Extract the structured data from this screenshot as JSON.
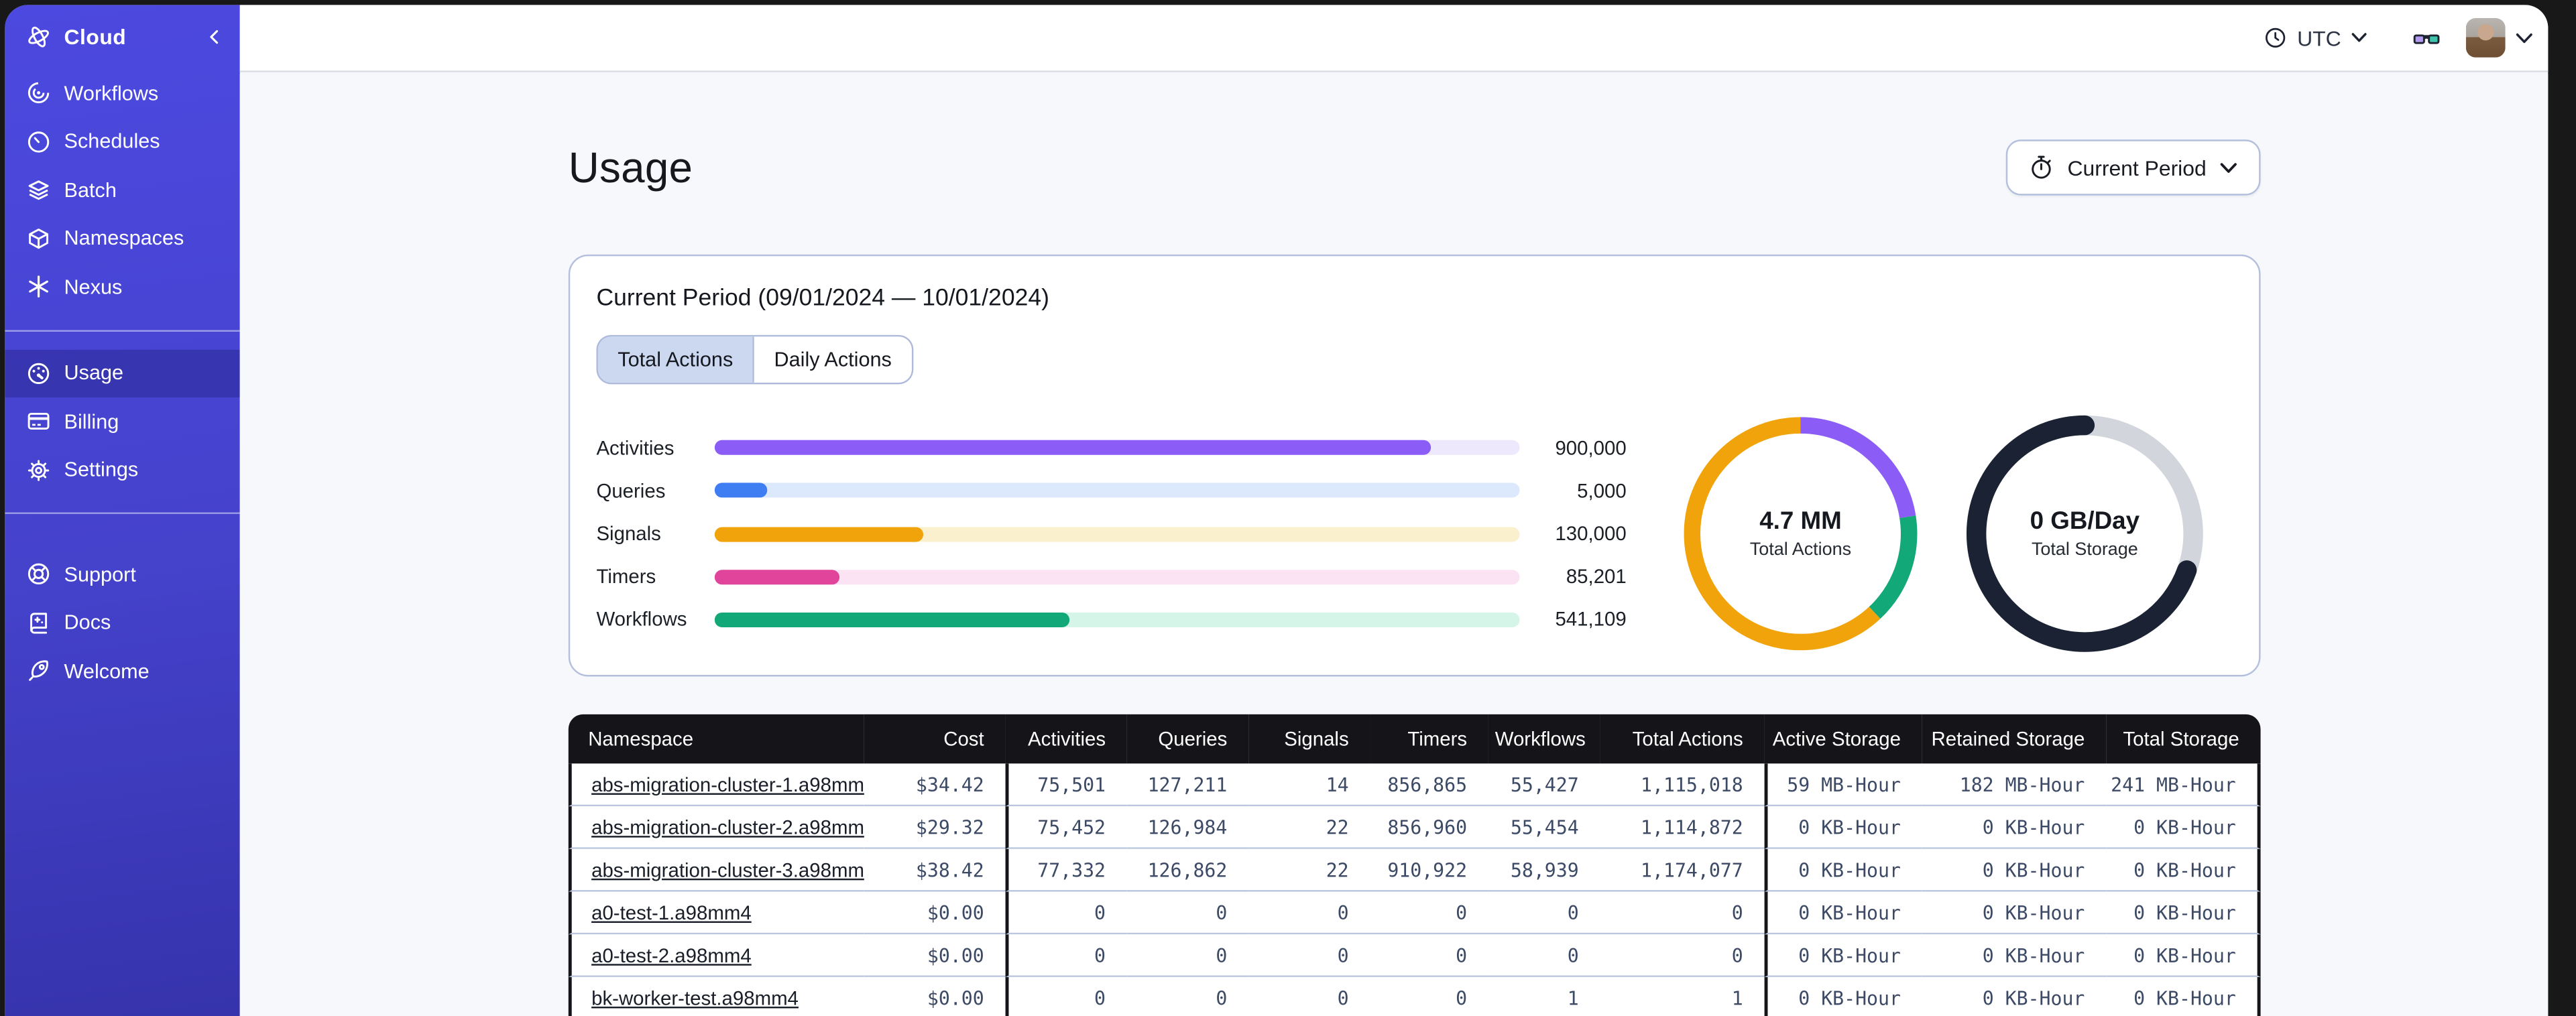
{
  "colors": {
    "sidebar_indigo": "#4542cc",
    "content_bg": "#f7f8fb",
    "table_header_bg": "#141419",
    "card_border": "#b4c0dd",
    "tab_selected_bg": "#cbd8f0"
  },
  "sidebar": {
    "header": {
      "label": "Cloud"
    },
    "sections": [
      {
        "items": [
          {
            "label": "Workflows",
            "icon": "workflows-icon"
          },
          {
            "label": "Schedules",
            "icon": "schedules-icon"
          },
          {
            "label": "Batch",
            "icon": "batch-icon"
          },
          {
            "label": "Namespaces",
            "icon": "namespaces-icon"
          },
          {
            "label": "Nexus",
            "icon": "nexus-icon"
          }
        ]
      },
      {
        "items": [
          {
            "label": "Usage",
            "icon": "usage-icon",
            "active": true
          },
          {
            "label": "Billing",
            "icon": "billing-icon"
          },
          {
            "label": "Settings",
            "icon": "settings-icon"
          }
        ]
      },
      {
        "items": [
          {
            "label": "Support",
            "icon": "support-icon"
          },
          {
            "label": "Docs",
            "icon": "docs-icon"
          },
          {
            "label": "Welcome",
            "icon": "welcome-icon"
          }
        ]
      }
    ]
  },
  "topbar": {
    "timezone_label": "UTC"
  },
  "page": {
    "title": "Usage",
    "period_button_label": "Current Period"
  },
  "usage_card": {
    "title": "Current Period (09/01/2024 — 10/01/2024)",
    "tabs": [
      {
        "label": "Total Actions",
        "selected": true
      },
      {
        "label": "Daily Actions",
        "selected": false
      }
    ],
    "bars": [
      {
        "label": "Activities",
        "value": "900,000",
        "fraction": 0.89,
        "color": "#8b5cf6",
        "track_color": "#ede8fc"
      },
      {
        "label": "Queries",
        "value": "5,000",
        "fraction": 0.065,
        "color": "#3f7df3",
        "track_color": "#dce8fb"
      },
      {
        "label": "Signals",
        "value": "130,000",
        "fraction": 0.26,
        "color": "#f0a30a",
        "track_color": "#fbf0cd"
      },
      {
        "label": "Timers",
        "value": "85,201",
        "fraction": 0.155,
        "color": "#e1459b",
        "track_color": "#fbe3f3"
      },
      {
        "label": "Workflows",
        "value": "541,109",
        "fraction": 0.44,
        "color": "#12a877",
        "track_color": "#d5f5e8"
      }
    ],
    "donuts": [
      {
        "value": "4.7 MM",
        "label": "Total Actions",
        "stroke_width": 10,
        "round_cap": false,
        "segments": [
          {
            "name": "activities",
            "color": "#8b5cf6",
            "fraction": 0.225
          },
          {
            "name": "workflows",
            "color": "#12a877",
            "fraction": 0.155
          },
          {
            "name": "signals",
            "color": "#f0a30a",
            "fraction": 0.62
          }
        ]
      },
      {
        "value": "0 GB/Day",
        "label": "Total Storage",
        "stroke_width": 12,
        "round_cap": true,
        "track_color": "#d2d5db",
        "segments": [
          {
            "name": "storage",
            "color": "#1a2233",
            "fraction": 0.695
          }
        ]
      }
    ]
  },
  "table": {
    "columns": [
      {
        "key": "namespace",
        "label": "Namespace",
        "align": "left",
        "type": "link"
      },
      {
        "key": "cost",
        "label": "Cost",
        "align": "right"
      },
      {
        "key": "activities",
        "label": "Activities",
        "align": "right",
        "divider_before": true
      },
      {
        "key": "queries",
        "label": "Queries",
        "align": "right"
      },
      {
        "key": "signals",
        "label": "Signals",
        "align": "right"
      },
      {
        "key": "timers",
        "label": "Timers",
        "align": "right"
      },
      {
        "key": "workflows",
        "label": "Workflows",
        "align": "right"
      },
      {
        "key": "total_actions",
        "label": "Total Actions",
        "align": "right"
      },
      {
        "key": "active_storage",
        "label": "Active Storage",
        "align": "right",
        "divider_before": true
      },
      {
        "key": "retained_storage",
        "label": "Retained Storage",
        "align": "right"
      },
      {
        "key": "total_storage",
        "label": "Total Storage",
        "align": "right"
      }
    ],
    "rows": [
      {
        "namespace": "abs-migration-cluster-1.a98mm4",
        "cost": "$34.42",
        "activities": "75,501",
        "queries": "127,211",
        "signals": "14",
        "timers": "856,865",
        "workflows": "55,427",
        "total_actions": "1,115,018",
        "active_storage": "59 MB-Hour",
        "retained_storage": "182 MB-Hour",
        "total_storage": "241 MB-Hour"
      },
      {
        "namespace": "abs-migration-cluster-2.a98mm4",
        "cost": "$29.32",
        "activities": "75,452",
        "queries": "126,984",
        "signals": "22",
        "timers": "856,960",
        "workflows": "55,454",
        "total_actions": "1,114,872",
        "active_storage": "0 KB-Hour",
        "retained_storage": "0 KB-Hour",
        "total_storage": "0 KB-Hour"
      },
      {
        "namespace": "abs-migration-cluster-3.a98mm4",
        "cost": "$38.42",
        "activities": "77,332",
        "queries": "126,862",
        "signals": "22",
        "timers": "910,922",
        "workflows": "58,939",
        "total_actions": "1,174,077",
        "active_storage": "0 KB-Hour",
        "retained_storage": "0 KB-Hour",
        "total_storage": "0 KB-Hour"
      },
      {
        "namespace": "a0-test-1.a98mm4",
        "cost": "$0.00",
        "activities": "0",
        "queries": "0",
        "signals": "0",
        "timers": "0",
        "workflows": "0",
        "total_actions": "0",
        "active_storage": "0 KB-Hour",
        "retained_storage": "0 KB-Hour",
        "total_storage": "0 KB-Hour"
      },
      {
        "namespace": "a0-test-2.a98mm4",
        "cost": "$0.00",
        "activities": "0",
        "queries": "0",
        "signals": "0",
        "timers": "0",
        "workflows": "0",
        "total_actions": "0",
        "active_storage": "0 KB-Hour",
        "retained_storage": "0 KB-Hour",
        "total_storage": "0 KB-Hour"
      },
      {
        "namespace": "bk-worker-test.a98mm4",
        "cost": "$0.00",
        "activities": "0",
        "queries": "0",
        "signals": "0",
        "timers": "0",
        "workflows": "1",
        "total_actions": "1",
        "active_storage": "0 KB-Hour",
        "retained_storage": "0 KB-Hour",
        "total_storage": "0 KB-Hour"
      }
    ]
  }
}
